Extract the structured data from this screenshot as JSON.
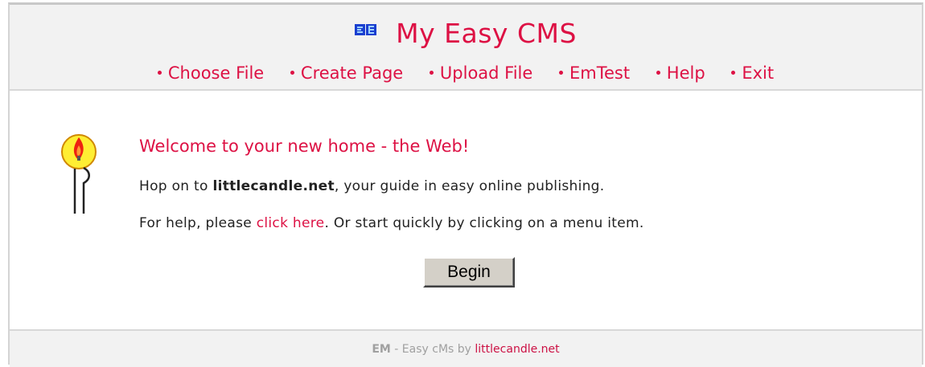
{
  "app": {
    "logo_icon": "eb-logo-icon",
    "title": "My Easy CMS"
  },
  "menu": {
    "items": [
      {
        "label": "Choose File"
      },
      {
        "label": "Create Page"
      },
      {
        "label": "Upload File"
      },
      {
        "label": "EmTest"
      },
      {
        "label": "Help"
      },
      {
        "label": "Exit"
      }
    ]
  },
  "main": {
    "icon": "candle-icon",
    "welcome": "Welcome to your new home - the Web!",
    "line1_prefix": "Hop on to ",
    "line1_bold": "littlecandle.net",
    "line1_suffix": ", your guide in easy online publishing.",
    "line2_prefix": "For help, please ",
    "line2_link": "click here",
    "line2_suffix": ". Or start quickly by clicking on a menu item.",
    "begin_label": "Begin"
  },
  "footer": {
    "strong": "EM",
    "text": " - Easy cMs by ",
    "link": "littlecandle.net"
  },
  "colors": {
    "accent": "#dd1144",
    "header_bg": "#f2f2f2",
    "footer_text": "#a0a0a0"
  }
}
